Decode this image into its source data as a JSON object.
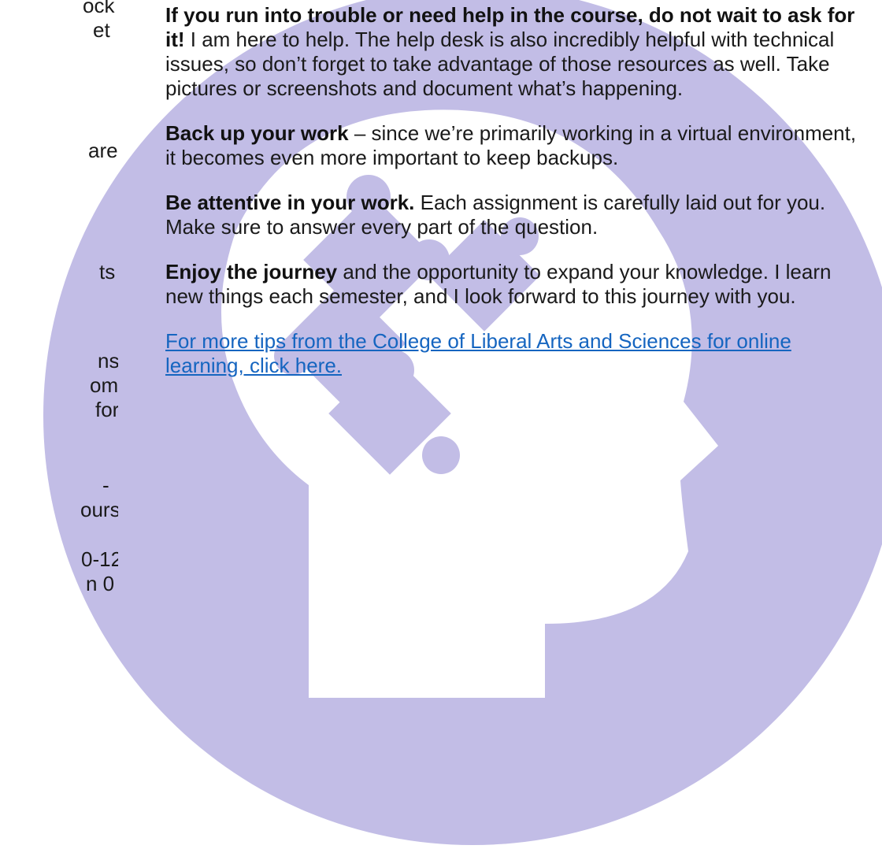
{
  "colors": {
    "circle": "#c2bde6",
    "head": "#ffffff",
    "link": "#1565c0",
    "text": "#1a1a1a"
  },
  "left_fragments": [
    "ock",
    "et",
    "are",
    "ts",
    "ns",
    "om.",
    "for",
    "-",
    "ours",
    "0-12",
    "n 0"
  ],
  "paragraphs": [
    {
      "lead": "If you run into trouble or need help in the course, do not wait to ask for it!",
      "body": " I am here to help. The help desk is also incredibly helpful with technical issues, so don’t forget to take advantage of those resources as well. Take pictures or screenshots and document what’s happening."
    },
    {
      "lead": "Back up your work",
      "body": " – since we’re primarily working in a virtual environment, it becomes even more important to keep backups."
    },
    {
      "lead": "Be attentive in your work.",
      "body": " Each assignment is carefully laid out for you. Make sure to answer every part of the question."
    },
    {
      "lead": "Enjoy the journey",
      "body": " and the opportunity to expand your knowledge. I learn new things each semester, and I look forward to this journey with you."
    }
  ],
  "link_text": "For more tips from the College of Liberal Arts and Sciences for online learning, click here."
}
